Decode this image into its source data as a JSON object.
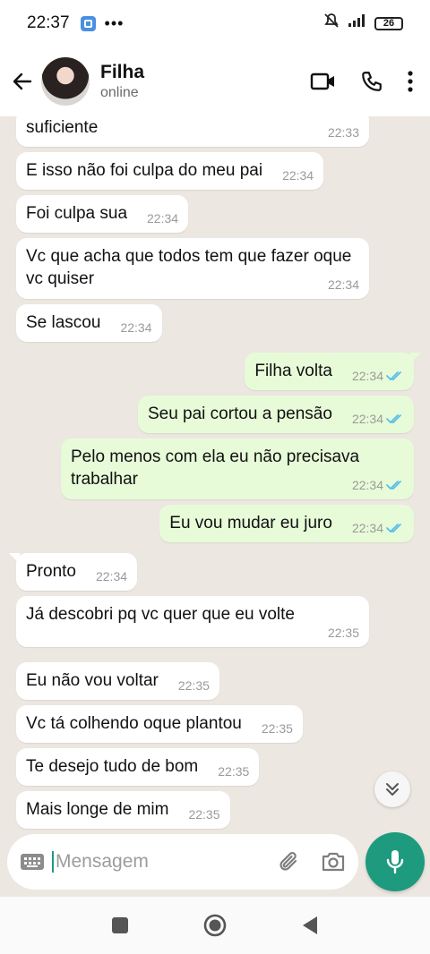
{
  "status_bar": {
    "time": "22:37",
    "dots": "•••",
    "battery": "26"
  },
  "header": {
    "contact_name": "Filha",
    "contact_status": "online"
  },
  "messages": [
    {
      "dir": "in",
      "text": "suficiente",
      "time": "22:33"
    },
    {
      "dir": "in",
      "text": "E isso não foi culpa do meu pai",
      "time": "22:34"
    },
    {
      "dir": "in",
      "text": "Foi culpa sua",
      "time": "22:34"
    },
    {
      "dir": "in",
      "text": "Vc que acha que todos tem que fazer oque vc quiser",
      "time": "22:34"
    },
    {
      "dir": "in",
      "text": "Se lascou",
      "time": "22:34"
    },
    {
      "dir": "out",
      "text": "Filha volta",
      "time": "22:34"
    },
    {
      "dir": "out",
      "text": "Seu pai cortou a pensão",
      "time": "22:34"
    },
    {
      "dir": "out",
      "text": "Pelo menos com ela eu não precisava trabalhar",
      "time": "22:34"
    },
    {
      "dir": "out",
      "text": "Eu vou mudar eu juro",
      "time": "22:34"
    },
    {
      "dir": "in",
      "text": "Pronto",
      "time": "22:34"
    },
    {
      "dir": "in",
      "text": "Já descobri pq vc quer que eu volte",
      "time": "22:35"
    },
    {
      "dir": "in",
      "text": "Eu não vou voltar",
      "time": "22:35"
    },
    {
      "dir": "in",
      "text": "Vc tá colhendo oque plantou",
      "time": "22:35"
    },
    {
      "dir": "in",
      "text": "Te desejo tudo de bom",
      "time": "22:35"
    },
    {
      "dir": "in",
      "text": "Mais longe de mim",
      "time": "22:35"
    }
  ],
  "composer": {
    "placeholder": "Mensagem"
  },
  "colors": {
    "accent": "#1e9a7e",
    "outgoing_bubble": "#e7fbd8",
    "incoming_bubble": "#ffffff",
    "read_ticks": "#53bdeb"
  }
}
